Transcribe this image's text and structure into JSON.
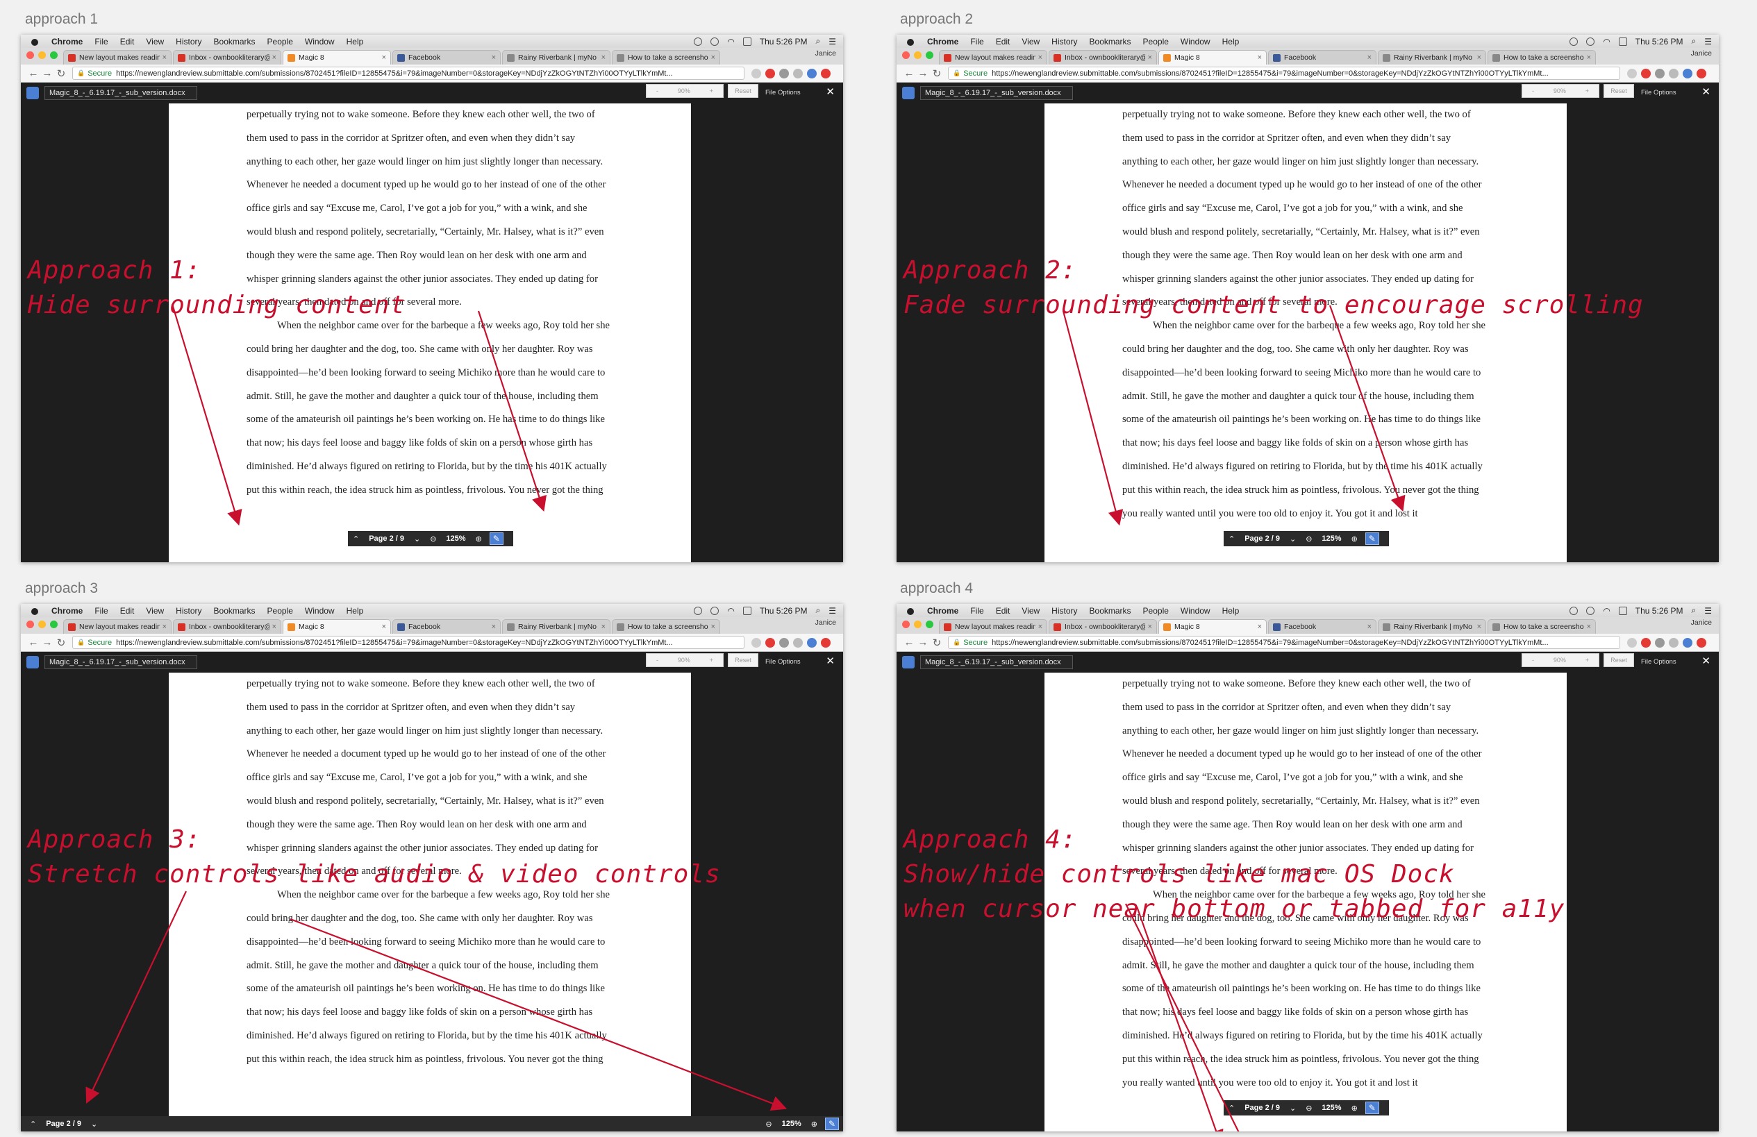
{
  "browser": {
    "menu": [
      "Chrome",
      "File",
      "Edit",
      "View",
      "History",
      "Bookmarks",
      "People",
      "Window",
      "Help"
    ],
    "clock": "Thu 5:26 PM",
    "tabs": [
      {
        "title": "New layout makes reading",
        "fav": "#d93025",
        "active": false
      },
      {
        "title": "Inbox - ownbookliterary@",
        "fav": "#d93025",
        "active": false
      },
      {
        "title": "Magic 8",
        "fav": "#f08a24",
        "active": true
      },
      {
        "title": "Facebook",
        "fav": "#3b5998",
        "active": false
      },
      {
        "title": "Rainy Riverbank | myNo",
        "fav": "#888888",
        "active": false
      },
      {
        "title": "How to take a screensho",
        "fav": "#888888",
        "active": false
      }
    ],
    "user": "Janice",
    "secure": "Secure",
    "url": "https://newenglandreview.submittable.com/submissions/8702451?fileID=12855475&i=79&imageNumber=0&storageKey=NDdjYzZkOGYtNTZhYi00OTYyLTlkYmMt..."
  },
  "viewer": {
    "doc_name": "Magic_8_-_6.19.17_-_sub_version.docx",
    "zoom_minus": "-",
    "zoom_level": "90%",
    "zoom_plus": "+",
    "reset": "Reset",
    "file_options": "File Options",
    "close": "✕",
    "page_indicator": "Page 2 / 9",
    "zoom_percent": "125%"
  },
  "document_lines": [
    {
      "text": "perpetually trying not to wake someone. Before they knew each other well, the two of",
      "indent": false
    },
    {
      "text": "them used to pass in the corridor at Spritzer often, and even when they didn’t say",
      "indent": false
    },
    {
      "text": "anything to each other, her gaze would linger on him just slightly longer than necessary.",
      "indent": false
    },
    {
      "text": "Whenever he needed a document typed up he would go to her instead of one of the other",
      "indent": false
    },
    {
      "text": "office girls and say “Excuse me, Carol, I’ve got a job for you,” with a wink, and she",
      "indent": false
    },
    {
      "text": "would blush and respond politely, secretarially, “Certainly, Mr. Halsey, what is it?” even",
      "indent": false
    },
    {
      "text": "though they were the same age. Then Roy would lean on her desk with one arm and",
      "indent": false
    },
    {
      "text": "whisper grinning slanders against the other junior associates. They ended up dating for",
      "indent": false
    },
    {
      "text": "several years, then dated on and off for several more.",
      "indent": false
    },
    {
      "text": "When the neighbor came over for the barbeque a few weeks ago, Roy told her she",
      "indent": true
    },
    {
      "text": "could bring her daughter and the dog, too. She came with only her daughter. Roy was",
      "indent": false
    },
    {
      "text": "disappointed—he’d been looking forward to seeing Michiko more than he would care to",
      "indent": false
    },
    {
      "text": "admit. Still, he gave the mother and daughter a quick tour of the house, including them",
      "indent": false
    },
    {
      "text": "some of the amateurish oil paintings he’s been working on. He has time to do things like",
      "indent": false
    },
    {
      "text": "that now; his days feel loose and baggy like folds of skin on a person whose girth has",
      "indent": false
    },
    {
      "text": "diminished. He’d always figured on retiring to Florida, but by the time his 401K actually",
      "indent": false
    },
    {
      "text": "put this within reach, the idea struck him as pointless, frivolous. You never got the thing",
      "indent": false
    },
    {
      "text": "you really wanted until you were too old to enjoy it. You got it and lost it",
      "indent": false
    }
  ],
  "panels": [
    {
      "label": "approach 1",
      "annotation": [
        "Approach 1:",
        "Hide surrounding content"
      ]
    },
    {
      "label": "approach 2",
      "annotation": [
        "Approach 2:",
        "Fade surrounding content to encourage scrolling"
      ]
    },
    {
      "label": "approach 3",
      "annotation": [
        "Approach 3:",
        "Stretch controls like audio & video controls"
      ]
    },
    {
      "label": "approach 4",
      "annotation": [
        "Approach 4:",
        "Show/hide controls like mac OS Dock",
        "when cursor near bottom or tabbed for a11y"
      ]
    }
  ],
  "colors": {
    "annotation": "#c8102e",
    "accent": "#4a7fd4"
  }
}
